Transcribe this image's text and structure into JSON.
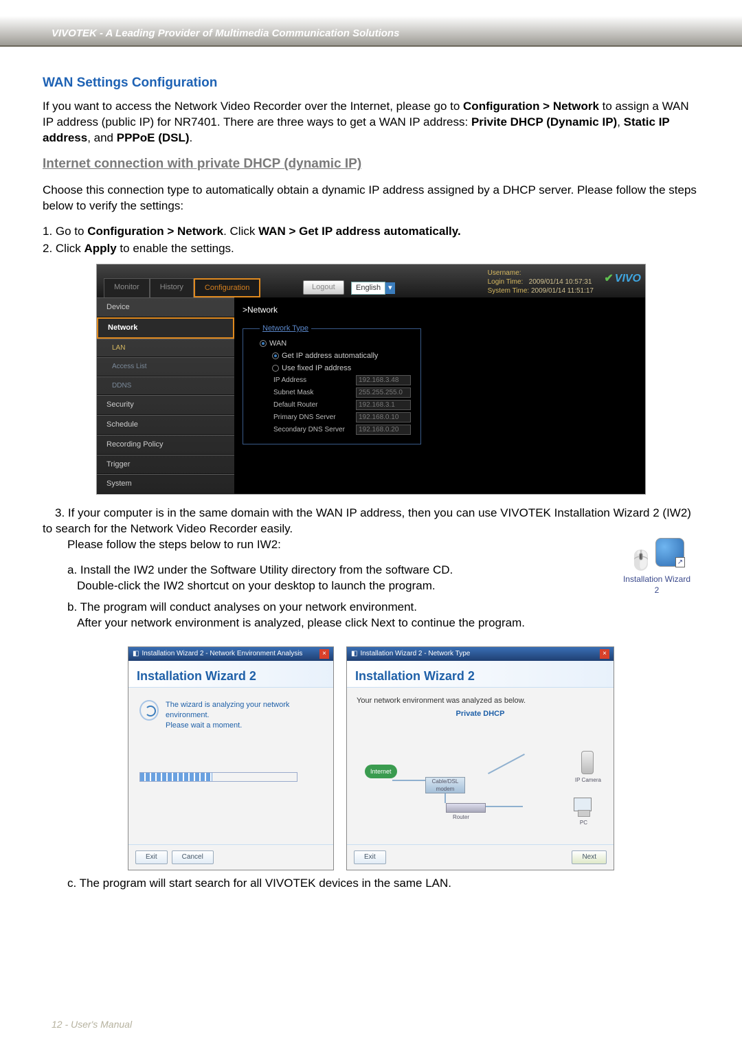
{
  "header": {
    "brand": "VIVOTEK - A Leading Provider of Multimedia Communication Solutions"
  },
  "section_title": "WAN Settings Configuration",
  "intro": {
    "t1": "If you want to access the Network Video Recorder over the Internet, please go to ",
    "b1": "Configuration > Network",
    "t2": " to assign a WAN IP address (public IP) for NR7401. There are three ways to get a WAN IP address: ",
    "b2": "Privite DHCP (Dynamic IP)",
    "t3": ", ",
    "b3": "Static IP address",
    "t4": ", and ",
    "b4": "PPPoE (DSL)",
    "t5": "."
  },
  "subhead": "Internet connection with private DHCP (dynamic IP)",
  "para2": "Choose this connection type to automatically obtain a dynamic IP address assigned by a DHCP server. Please follow the steps below to verify the settings:",
  "step1": {
    "p": "1. Go to ",
    "b1": "Configuration > Network",
    "m": ". Click ",
    "b2": "WAN > Get IP address automatically."
  },
  "step2": {
    "p": "2. Click ",
    "b1": "Apply",
    "m": " to enable the settings."
  },
  "app": {
    "tabs": {
      "monitor": "Monitor",
      "history": "History",
      "configuration": "Configuration"
    },
    "logout": "Logout",
    "lang": "English",
    "user_hdr": "Username:",
    "login_label": "Login Time:",
    "login_time": "2009/01/14 10:57:31",
    "system_label": "System Time:",
    "system_time": "2009/01/14 11:51:17",
    "logo": "VIVO",
    "crumb": ">Network",
    "sidebar": {
      "device": "Device",
      "network": "Network",
      "lan": "LAN",
      "access": "Access List",
      "ddns": "DDNS",
      "security": "Security",
      "schedule": "Schedule",
      "recording": "Recording Policy",
      "trigger": "Trigger",
      "system": "System"
    },
    "fieldset": {
      "legend": "Network Type",
      "wan": "WAN",
      "auto": "Get IP address automatically",
      "fixed": "Use fixed IP address",
      "ip_l": "IP Address",
      "ip_v": "192.168.3.48",
      "sm_l": "Subnet Mask",
      "sm_v": "255.255.255.0",
      "dr_l": "Default Router",
      "dr_v": "192.168.3.1",
      "pd_l": "Primary DNS Server",
      "pd_v": "192.168.0.10",
      "sd_l": "Secondary DNS Server",
      "sd_v": "192.168.0.20"
    }
  },
  "step3": {
    "main": "3. If your computer is in the same domain with the WAN IP address, then you can use VIVOTEK Installation Wizard 2 (IW2) to search for the Network Video Recorder easily.",
    "main2": "Please follow the steps below to run IW2:",
    "a1": "a. Install the IW2 under the Software Utility directory from the software CD.",
    "a2": "Double-click the IW2 shortcut on your desktop to launch the program.",
    "b1": "b. The program will conduct analyses on your network environment.",
    "b2": "After your network environment is analyzed, please click Next to continue the program.",
    "c": "c. The program will start search for all VIVOTEK devices in the same LAN.",
    "iw2_label": "Installation Wizard 2"
  },
  "wiz1": {
    "bar": "Installation Wizard 2 - Network Environment Analysis",
    "head": "Installation Wizard 2",
    "line1": "The wizard is analyzing your network environment.",
    "line2": "Please wait a moment.",
    "exit": "Exit",
    "cancel": "Cancel"
  },
  "wiz2": {
    "bar": "Installation Wizard 2 - Network Type",
    "head": "Installation Wizard 2",
    "analyzed": "Your network environment was analyzed as below.",
    "priv": "Private DHCP",
    "internet": "Internet",
    "modem": "Cable/DSL modem",
    "router": "Router",
    "ipcam": "IP Camera",
    "pc": "PC",
    "exit": "Exit",
    "next": "Next"
  },
  "footer": "12 - User's Manual"
}
